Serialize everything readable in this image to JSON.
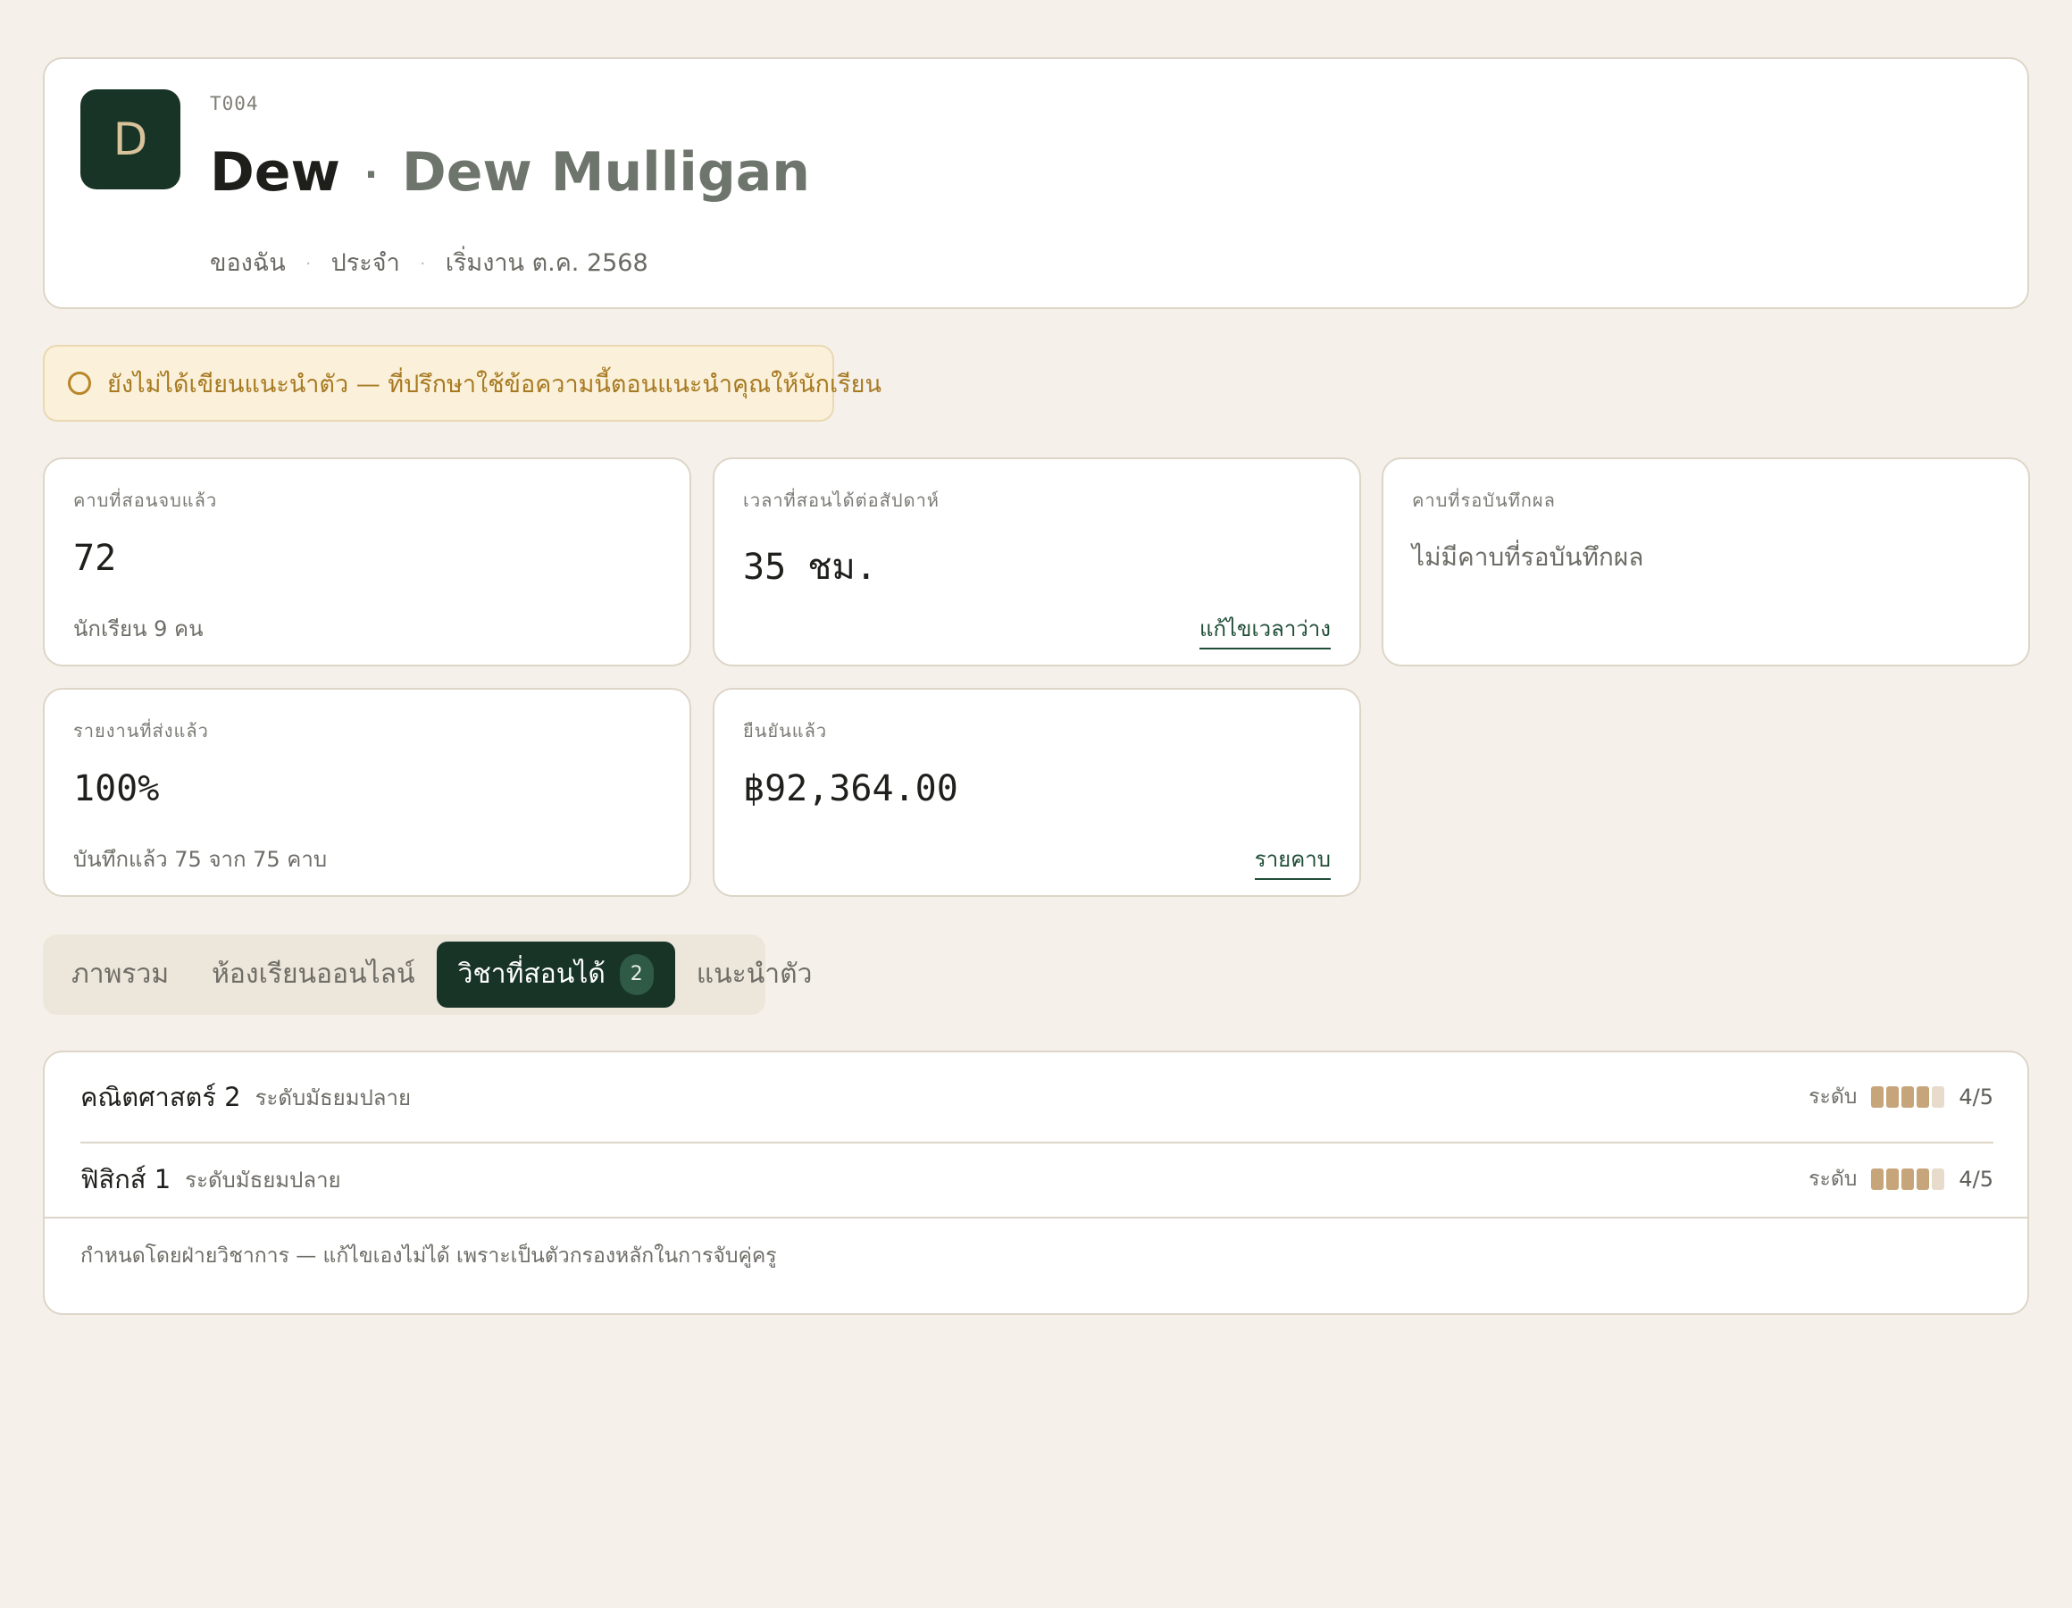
{
  "profile": {
    "avatar_initial": "D",
    "code": "T004",
    "nickname": "Dew",
    "separator": "·",
    "full_name": "Dew Mulligan",
    "meta": [
      "ของฉัน",
      "ประจำ",
      "เริ่มงาน ต.ค. 2568"
    ],
    "meta_separator": "·"
  },
  "notice": {
    "icon": "circle-outline-icon",
    "text": "ยังไม่ได้เขียนแนะนำตัว — ที่ปรึกษาใช้ข้อความนี้ตอนแนะนำคุณให้นักเรียน"
  },
  "stats": {
    "completed": {
      "label": "คาบที่สอนจบแล้ว",
      "value": "72",
      "sub": "นักเรียน 9 คน"
    },
    "weekly": {
      "label": "เวลาที่สอนได้ต่อสัปดาห์",
      "value": "35 ชม.",
      "link": "แก้ไขเวลาว่าง"
    },
    "pending": {
      "label": "คาบที่รอบันทึกผล",
      "empty": "ไม่มีคาบที่รอบันทึกผล"
    },
    "reports": {
      "label": "รายงานที่ส่งแล้ว",
      "value": "100%",
      "sub": "บันทึกแล้ว 75 จาก 75 คาบ"
    },
    "confirmed": {
      "label": "ยืนยันแล้ว",
      "value": "฿92,364.00",
      "link": "รายคาบ"
    }
  },
  "tabs": [
    {
      "label": "ภาพรวม",
      "active": false
    },
    {
      "label": "ห้องเรียนออนไลน์",
      "active": false
    },
    {
      "label": "วิชาที่สอนได้",
      "active": true,
      "badge": "2"
    },
    {
      "label": "แนะนำตัว",
      "active": false
    }
  ],
  "subjects": {
    "items": [
      {
        "name": "คณิตศาสตร์ 2",
        "level_name": "ระดับมัธยมปลาย",
        "level_label": "ระดับ",
        "level": 4,
        "max": 5,
        "level_text": "4/5"
      },
      {
        "name": "ฟิสิกส์ 1",
        "level_name": "ระดับมัธยมปลาย",
        "level_label": "ระดับ",
        "level": 4,
        "max": 5,
        "level_text": "4/5"
      }
    ],
    "footer": "กำหนดโดยฝ่ายวิชาการ — แก้ไขเองไม่ได้ เพราะเป็นตัวกรองหลักในการจับคู่ครู"
  },
  "colors": {
    "background": "#f5f1ea",
    "brand_dark": "#183426",
    "accent_gold": "#c7a57a",
    "notice_bg": "#fbf0d9",
    "notice_text": "#a77a22"
  }
}
